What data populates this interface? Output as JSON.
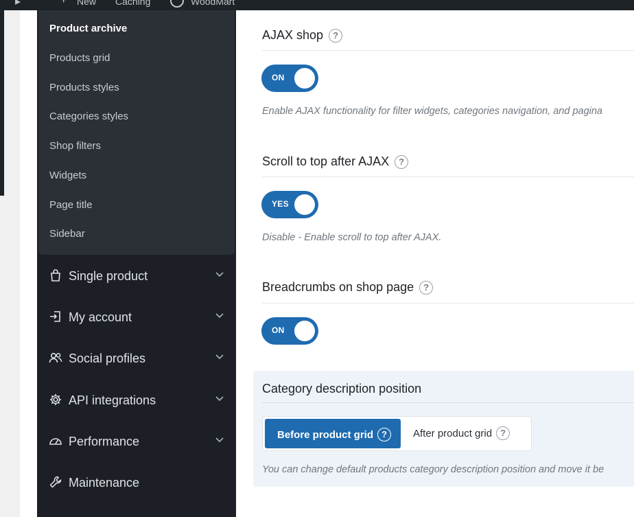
{
  "adminbar": {
    "new_label": "New",
    "caching_label": "Caching",
    "woodmart_label": "WoodMart"
  },
  "sidebar": {
    "submenu": [
      {
        "label": "Product archive",
        "active": true
      },
      {
        "label": "Products grid"
      },
      {
        "label": "Products styles"
      },
      {
        "label": "Categories styles"
      },
      {
        "label": "Shop filters"
      },
      {
        "label": "Widgets"
      },
      {
        "label": "Page title"
      },
      {
        "label": "Sidebar"
      }
    ],
    "menu": [
      {
        "label": "Single product",
        "icon": "shopping-bag-icon",
        "has_children": true
      },
      {
        "label": "My account",
        "icon": "login-icon",
        "has_children": true
      },
      {
        "label": "Social profiles",
        "icon": "users-icon",
        "has_children": true
      },
      {
        "label": "API integrations",
        "icon": "gear-icon",
        "has_children": true
      },
      {
        "label": "Performance",
        "icon": "speedometer-icon",
        "has_children": true
      },
      {
        "label": "Maintenance",
        "icon": "wrench-icon",
        "has_children": false
      }
    ]
  },
  "main": {
    "ajax_shop": {
      "title": "AJAX shop",
      "help": "?",
      "toggle_label": "ON",
      "description": "Enable AJAX functionality for filter widgets, categories navigation, and pagina"
    },
    "scroll_top": {
      "title": "Scroll to top after AJAX",
      "help": "?",
      "toggle_label": "YES",
      "description": "Disable - Enable scroll to top after AJAX."
    },
    "breadcrumbs": {
      "title": "Breadcrumbs on shop page",
      "help": "?",
      "toggle_label": "ON"
    },
    "category_description": {
      "title": "Category description position",
      "options": [
        {
          "label": "Before product grid",
          "help": "?",
          "selected": true
        },
        {
          "label": "After product grid",
          "help": "?",
          "selected": false
        }
      ],
      "description": "You can change default products category description position and move it be"
    }
  },
  "colors": {
    "accent": "#1f6bb0",
    "sidebar_bg": "#1c2026",
    "submenu_bg": "#2b3037",
    "panel_bg": "#eef3f9"
  }
}
